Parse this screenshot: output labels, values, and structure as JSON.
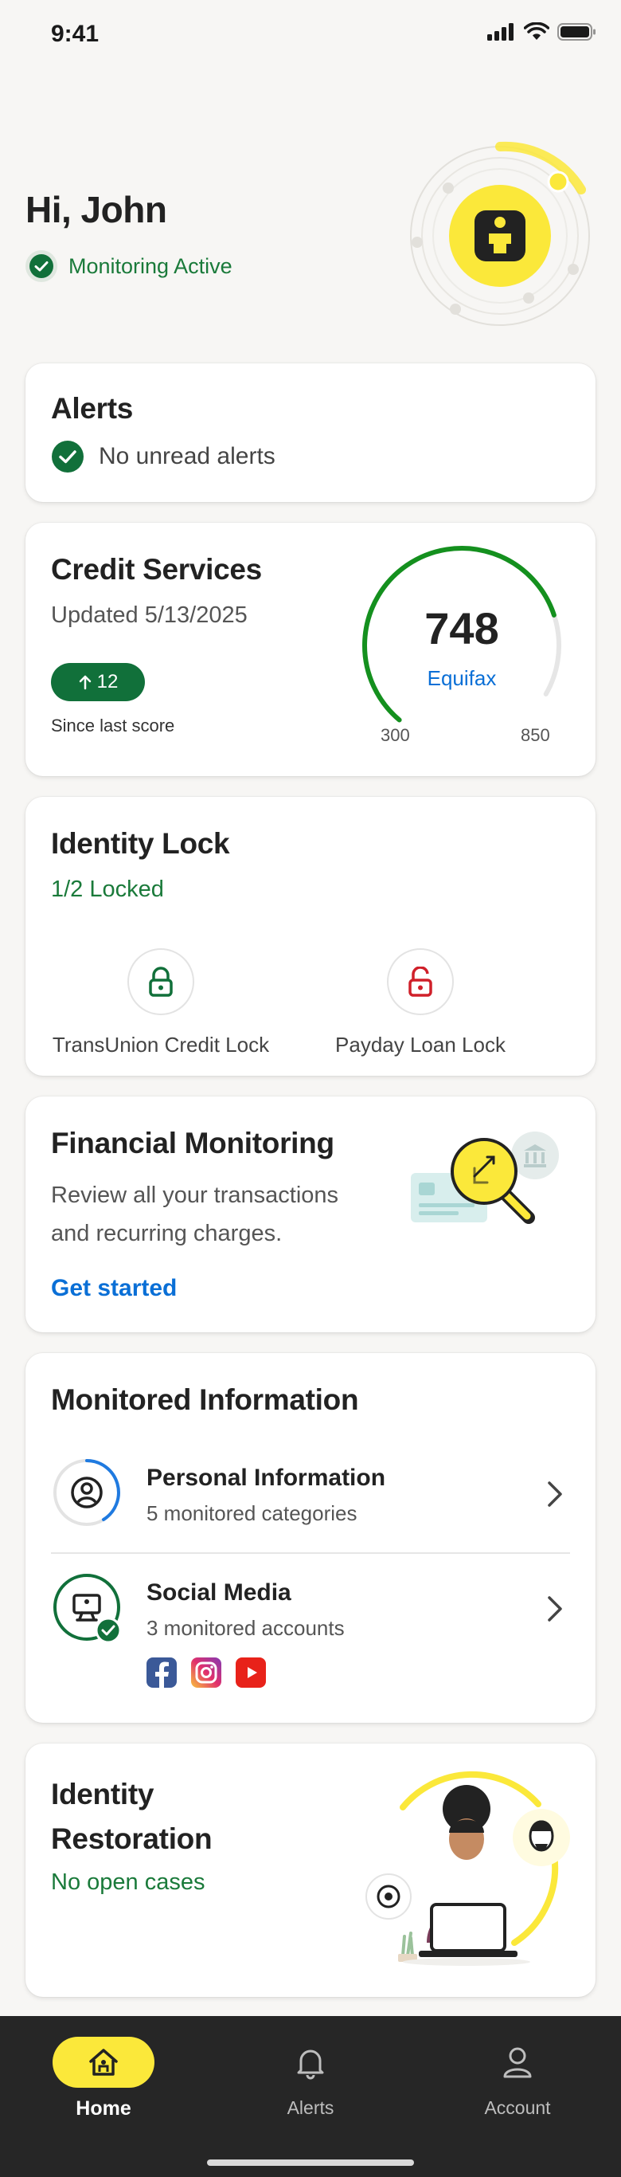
{
  "status_bar": {
    "time": "9:41"
  },
  "header": {
    "greeting": "Hi, John",
    "monitoring_status": "Monitoring Active"
  },
  "alerts_card": {
    "title": "Alerts",
    "status": "No unread alerts"
  },
  "credit_card": {
    "title": "Credit Services",
    "updated": "Updated 5/13/2025",
    "change": "12",
    "change_caption": "Since last score",
    "score": "748",
    "bureau": "Equifax",
    "min": "300",
    "max": "850",
    "score_value": 748,
    "score_min": 300,
    "score_max": 850
  },
  "identity_lock": {
    "title": "Identity Lock",
    "status": "1/2 Locked",
    "locks": [
      {
        "label": "TransUnion Credit Lock",
        "state": "locked",
        "color": "#11703a"
      },
      {
        "label": "Payday Loan Lock",
        "state": "unlocked",
        "color": "#d0202a"
      }
    ]
  },
  "financial": {
    "title": "Financial Monitoring",
    "desc_line1": "Review all your transactions",
    "desc_line2": "and recurring charges.",
    "cta": "Get started"
  },
  "monitored": {
    "title": "Monitored Information",
    "items": [
      {
        "title": "Personal Information",
        "subtitle": "5 monitored categories",
        "icon": "person-icon"
      },
      {
        "title": "Social Media",
        "subtitle": "3 monitored accounts",
        "icon": "monitor-icon"
      }
    ]
  },
  "restoration": {
    "title_line1": "Identity",
    "title_line2": "Restoration",
    "status": "No open cases"
  },
  "nav": {
    "home": "Home",
    "alerts": "Alerts",
    "account": "Account"
  },
  "colors": {
    "brand_yellow": "#fbe83a",
    "brand_green": "#11703a",
    "link_blue": "#0a6fd6"
  }
}
